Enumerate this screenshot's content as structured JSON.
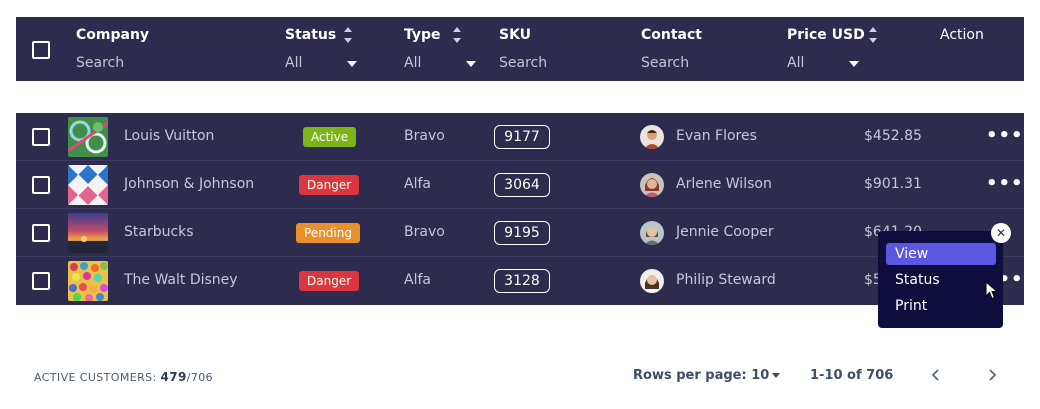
{
  "header": {
    "columns": [
      {
        "label": "Company",
        "filter": "Search"
      },
      {
        "label": "Status",
        "filter": "All"
      },
      {
        "label": "Type",
        "filter": "All"
      },
      {
        "label": "SKU",
        "filter": "Search"
      },
      {
        "label": "Contact",
        "filter": "Search"
      },
      {
        "label": "Price USD",
        "filter": "All"
      },
      {
        "label": "Action",
        "filter": ""
      }
    ]
  },
  "rows": [
    {
      "company": "Louis Vuitton",
      "status": "Active",
      "type": "Bravo",
      "sku": "9177",
      "contact": "Evan Flores",
      "price": "$452.85"
    },
    {
      "company": "Johnson & Johnson",
      "status": "Danger",
      "type": "Alfa",
      "sku": "3064",
      "contact": "Arlene Wilson",
      "price": "$901.31"
    },
    {
      "company": "Starbucks",
      "status": "Pending",
      "type": "Bravo",
      "sku": "9195",
      "contact": "Jennie Cooper",
      "price": "$641.20"
    },
    {
      "company": "The Walt Disney",
      "status": "Danger",
      "type": "Alfa",
      "sku": "3128",
      "contact": "Philip Steward",
      "price": "$5"
    }
  ],
  "status_colors": {
    "Active": "#7cb518",
    "Danger": "#d9363e",
    "Pending": "#e8902b"
  },
  "action_menu": {
    "items": [
      "View",
      "Status",
      "Print"
    ],
    "highlighted": "View",
    "close_glyph": "✕"
  },
  "footer": {
    "active_label": "ACTIVE CUSTOMERS:",
    "active_count": "479",
    "active_total": "/706",
    "rows_per_page": "Rows per page: 10",
    "range": "1-10 of 706"
  },
  "colors": {
    "table_bg": "#2d2b4e",
    "menu_bg": "#0f0d3b",
    "menu_highlight": "#5b57e0"
  }
}
